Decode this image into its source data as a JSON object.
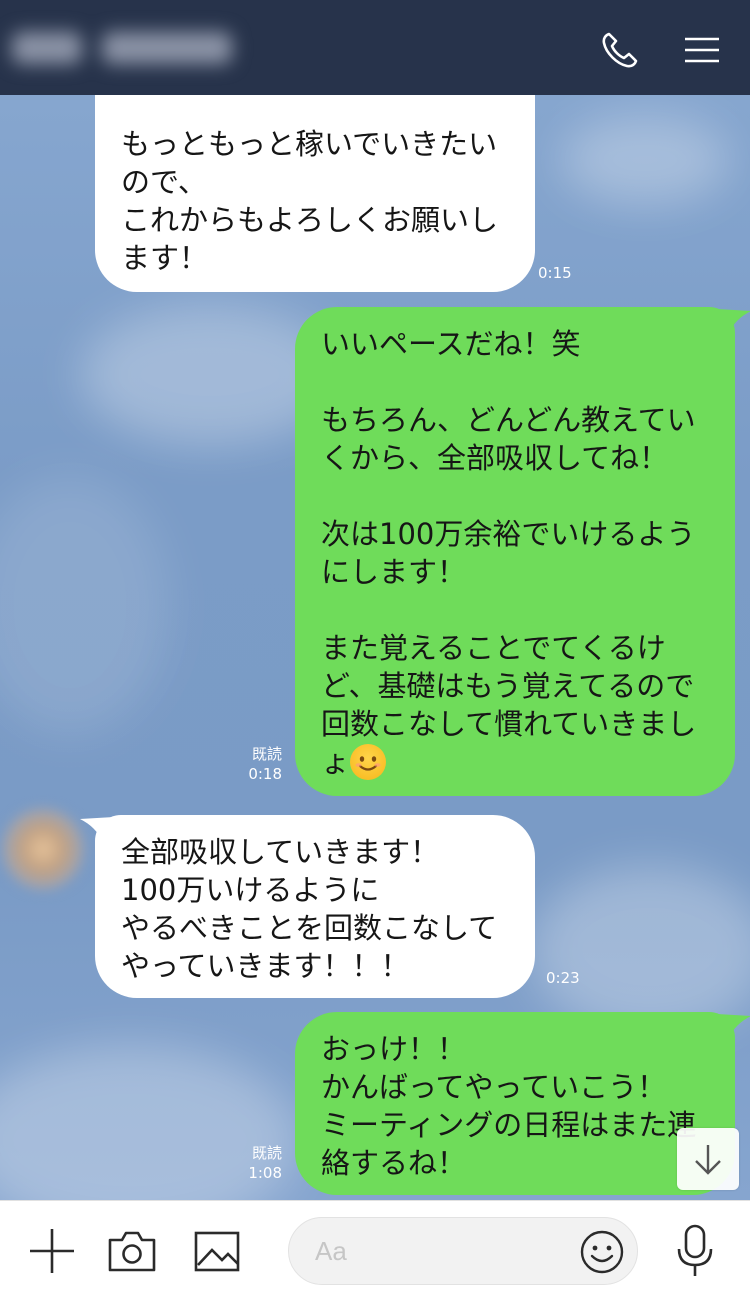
{
  "header": {
    "title": "",
    "call_icon": "phone-icon",
    "menu_icon": "hamburger-menu-icon"
  },
  "messages": [
    {
      "side": "in",
      "text": "もっともっと稼いでいきたいので、\nこれからもよろしくお願いします！",
      "time": "0:15"
    },
    {
      "side": "out",
      "text_parts": [
        "いいペースだね！笑\n\nもちろん、どんどん教えていくから、全部吸収してね！\n\n次は100万余裕でいけるようにします！\n\nまた覚えることでてくるけど、基礎はもう覚えてるので回数こなして慣れていきましょ",
        ""
      ],
      "emoji": "smiling-face-emoji",
      "read": "既読",
      "time": "0:18"
    },
    {
      "side": "in",
      "text": "全部吸収していきます！\n100万いけるように\nやるべきことを回数こなして\nやっていきます！！！",
      "time": "0:23"
    },
    {
      "side": "out",
      "text": "おっけ！！\nかんばってやっていこう！\nミーティングの日程はまた連絡するね！",
      "read": "既読",
      "time": "1:08"
    }
  ],
  "scroll_button_icon": "arrow-down-icon",
  "footer": {
    "input_placeholder": "Aa",
    "icons": [
      "plus-icon",
      "camera-icon",
      "image-icon",
      "emoji-icon",
      "microphone-icon"
    ]
  },
  "colors": {
    "header_bg": "#27334b",
    "incoming_bubble": "#ffffff",
    "outgoing_bubble": "#6fdc5a",
    "chat_bg": "#7f9fc6"
  }
}
